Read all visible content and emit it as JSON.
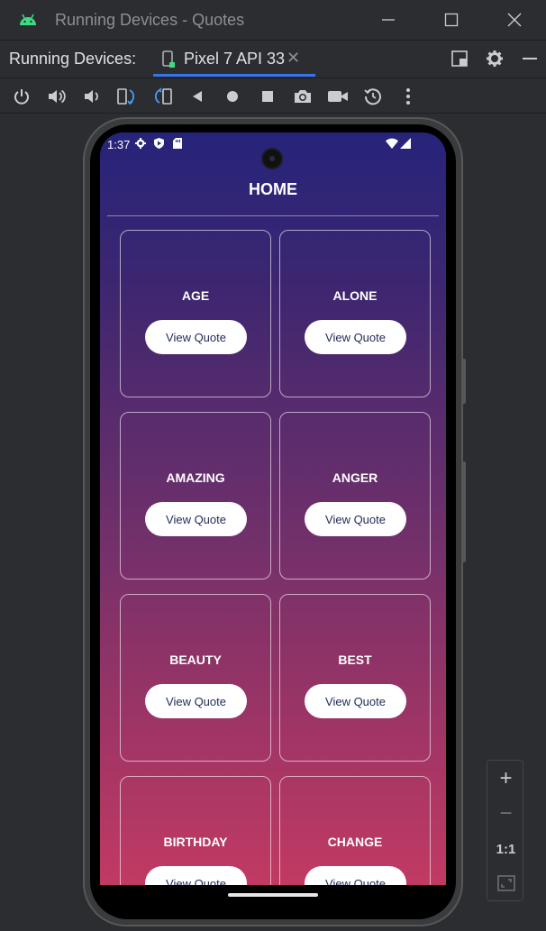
{
  "window": {
    "title": "Running Devices - Quotes",
    "minimize_glyph": "—",
    "maximize_glyph": "☐",
    "close_glyph": "✕"
  },
  "tabs_bar": {
    "label": "Running Devices:",
    "active_tab": "Pixel 7 API 33",
    "close_glyph": "✕"
  },
  "toolbar": {
    "icons": [
      "power-icon",
      "volume-up-icon",
      "volume-down-icon",
      "rotate-left-icon",
      "rotate-right-icon",
      "back-icon",
      "home-icon",
      "overview-icon",
      "screenshot-icon",
      "screen-record-icon",
      "reset-icon",
      "more-options-icon"
    ]
  },
  "device": {
    "status": {
      "time": "1:37"
    },
    "screen_title": "HOME",
    "cards": [
      {
        "category": "AGE",
        "button": "View Quote"
      },
      {
        "category": "ALONE",
        "button": "View Quote"
      },
      {
        "category": "AMAZING",
        "button": "View Quote"
      },
      {
        "category": "ANGER",
        "button": "View Quote"
      },
      {
        "category": "BEAUTY",
        "button": "View Quote"
      },
      {
        "category": "BEST",
        "button": "View Quote"
      },
      {
        "category": "BIRTHDAY",
        "button": "View Quote"
      },
      {
        "category": "CHANGE",
        "button": "View Quote"
      }
    ]
  },
  "zoom": {
    "plus": "+",
    "minus": "−",
    "one_to_one": "1:1"
  },
  "colors": {
    "ide_background": "#2b2d30",
    "accent": "#3574f0",
    "gradient_top": "#26247a",
    "gradient_bottom": "#c13a63",
    "button_text": "#1f2a55"
  }
}
